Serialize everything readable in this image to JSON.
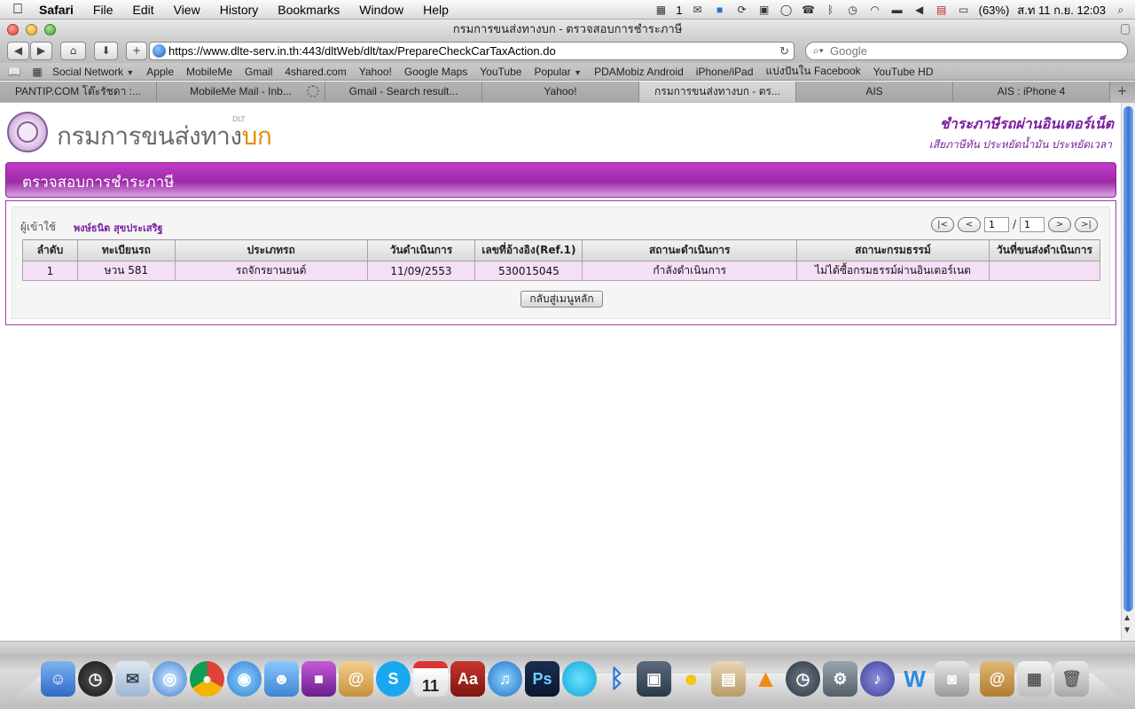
{
  "menubar": {
    "app": "Safari",
    "items": [
      "File",
      "Edit",
      "View",
      "History",
      "Bookmarks",
      "Window",
      "Help"
    ],
    "status_count": "1",
    "battery": "(63%)",
    "clock": "ส.ท 11 ก.ย.  12:03"
  },
  "window": {
    "title": "กรมการขนส่งทางบก - ตรวจสอบการชำระภาษี"
  },
  "toolbar": {
    "url": "https://www.dlte-serv.in.th:443/dltWeb/dlt/tax/PrepareCheckCarTaxAction.do",
    "search_placeholder": "Google"
  },
  "bookmarks": [
    "Social Network",
    "Apple",
    "MobileMe",
    "Gmail",
    "4shared.com",
    "Yahoo!",
    "Google Maps",
    "YouTube",
    "Popular",
    "PDAMobiz Android",
    "iPhone/iPad",
    "แบ่งปันใน Facebook",
    "YouTube HD"
  ],
  "tabs": [
    {
      "label": "PANTIP.COM โต๊ะรัชดา :..."
    },
    {
      "label": "MobileMe Mail - Inb..."
    },
    {
      "label": "Gmail - Search result..."
    },
    {
      "label": "Yahoo!"
    },
    {
      "label": "กรมการขนส่งทางบก - ตร..."
    },
    {
      "label": "AIS"
    },
    {
      "label": "AIS : iPhone 4"
    }
  ],
  "page": {
    "dept_name_a": "กรมการขนส่งทาง",
    "dept_name_b": "บก",
    "dept_abbr": "DLT",
    "slogan_title": "ชำระภาษีรถผ่านอินเตอร์เน็ต",
    "slogan_sub": "เสียภาษีทัน ประหยัดน้ำมัน ประหยัดเวลา",
    "banner_title": "ตรวจสอบการชำระภาษี",
    "user_label": "ผู้เข้าใช้",
    "user_name": "พงษ์ธนิต สุขประเสริฐ",
    "pager": {
      "first": "|<",
      "prev": "<",
      "current": "1",
      "sep": "/",
      "total": "1",
      "next": ">",
      "last": ">|"
    },
    "table": {
      "headers": [
        "ลำดับ",
        "ทะเบียนรถ",
        "ประเภทรถ",
        "วันดำเนินการ",
        "เลขที่อ้างอิง(Ref.1)",
        "สถานะดำเนินการ",
        "สถานะกรมธรรม์",
        "วันที่ขนส่งดำเนินการ"
      ],
      "rows": [
        [
          "1",
          "ษวน 581",
          "รถจักรยานยนต์",
          "11/09/2553",
          "530015045",
          "กำลังดำเนินการ",
          "ไม่ได้ซื้อกรมธรรม์ผ่านอินเตอร์เนต",
          ""
        ]
      ]
    },
    "back_button": "กลับสู่เมนูหลัก"
  },
  "dock": {
    "icons": [
      "finder",
      "dashboard",
      "mail",
      "safari",
      "chrome",
      "ichat",
      "address-book",
      "app-store",
      "notes",
      "skype",
      "ical",
      "dictionary",
      "itunes",
      "photoshop",
      "app",
      "bluetooth",
      "iphoto",
      "adium",
      "preview",
      "vlc",
      "time-machine",
      "system-preferences",
      "itunes-alt",
      "wordpress",
      "photo-booth",
      "documents",
      "downloads",
      "trash"
    ],
    "ical_day": "11",
    "skype_glyph": "S",
    "photoshop_glyph": "Ps",
    "dictionary_glyph": "Aa"
  },
  "colors": {
    "brand_purple": "#9d2aa8",
    "accent_orange": "#e68a00"
  }
}
